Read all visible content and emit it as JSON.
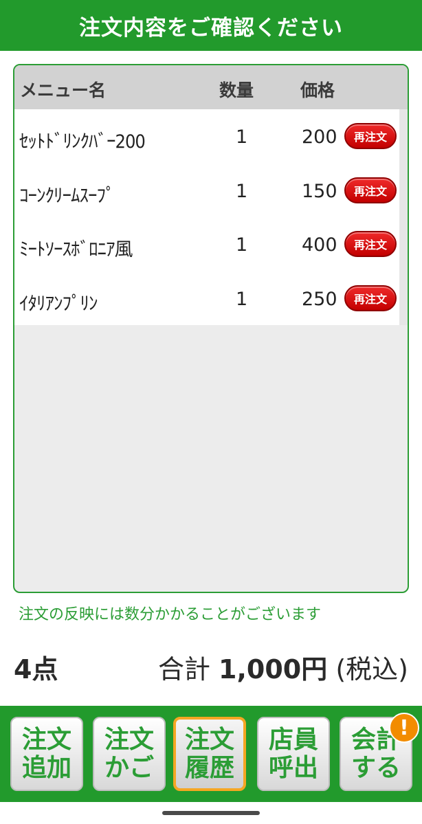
{
  "header": {
    "title": "注文内容をご確認ください"
  },
  "table": {
    "columns": {
      "name": "メニュー名",
      "qty": "数量",
      "price": "価格"
    },
    "reorder_label": "再注文",
    "rows": [
      {
        "name": "ｾｯﾄﾄﾞﾘﾝｸﾊﾞｰ200",
        "qty": "1",
        "price": "200"
      },
      {
        "name": "ｺｰﾝｸﾘｰﾑｽｰﾌﾟ",
        "qty": "1",
        "price": "150"
      },
      {
        "name": "ﾐｰﾄｿｰｽﾎﾞﾛﾆｱ風",
        "qty": "1",
        "price": "400"
      },
      {
        "name": "ｲﾀﾘｱﾝﾌﾟﾘﾝ",
        "qty": "1",
        "price": "250"
      }
    ]
  },
  "notice": "注文の反映には数分かかることがございます",
  "summary": {
    "count": "4点",
    "total_label": "合計",
    "total_amount": "1,000円",
    "tax_note": "(税込)"
  },
  "nav": {
    "add": [
      "注文",
      "追加"
    ],
    "cart": [
      "注文",
      "かご"
    ],
    "history": [
      "注文",
      "履歴"
    ],
    "call": [
      "店員",
      "呼出"
    ],
    "checkout": [
      "会計",
      "する"
    ],
    "checkout_badge": "!"
  },
  "colors": {
    "brand_green": "#229a2c",
    "reorder_red": "#d40000",
    "active_border": "#f5a623",
    "badge_orange": "#f28c00"
  }
}
